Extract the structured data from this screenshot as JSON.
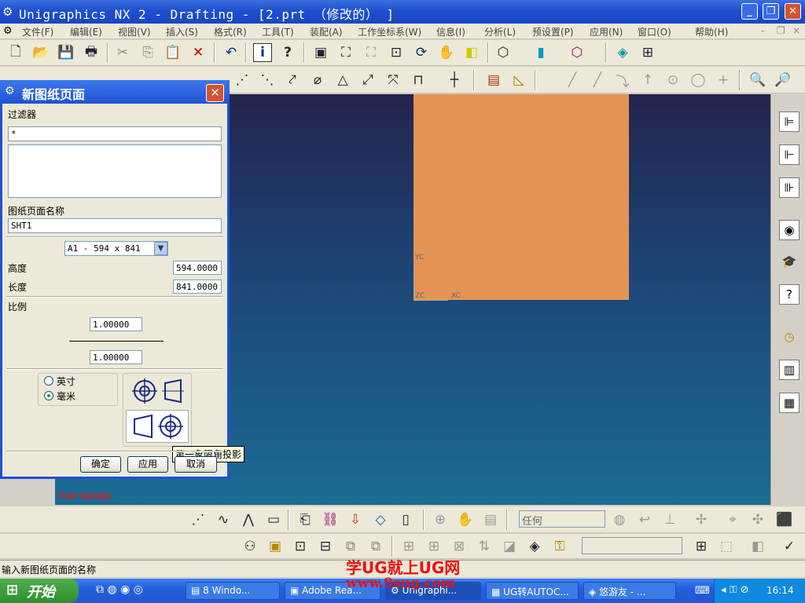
{
  "window": {
    "title": "Unigraphics NX 2 - Drafting - [2.prt  （修改的） ]",
    "btn_min": "_",
    "btn_max": "❐",
    "btn_close": "✕"
  },
  "menu": [
    {
      "label": "文件(F)"
    },
    {
      "label": "编辑(E)"
    },
    {
      "label": "视图(V)"
    },
    {
      "label": "插入(S)"
    },
    {
      "label": "格式(R)"
    },
    {
      "label": "工具(T)"
    },
    {
      "label": "装配(A)"
    },
    {
      "label": "工作坐标系(W)"
    },
    {
      "label": "信息(I)"
    },
    {
      "label": "分析(L)"
    },
    {
      "label": "预设置(P)"
    },
    {
      "label": "应用(N)"
    },
    {
      "label": "窗口(O)"
    },
    {
      "label": "帮助(H)"
    }
  ],
  "toolbar_icons": [
    "new-icon",
    "open-icon",
    "save-icon",
    "print-icon",
    "cut-icon",
    "copy-icon",
    "paste-icon",
    "delete-icon",
    "undo-icon",
    "info-icon",
    "help-icon",
    "view-icon",
    "fit-icon",
    "zoom-icon",
    "zoom-region-icon",
    "rotate-icon",
    "pan-icon",
    "shade-icon",
    "wireframe-icon",
    "render-icon",
    "box-icon",
    "model-icon",
    "sheet-icon"
  ],
  "dialog": {
    "title": "新图纸页面",
    "filter_label": "过滤器",
    "filter_value": "*",
    "name_label": "图纸页面名称",
    "name_value": "SHT1",
    "size_value": "A1 - 594 x 841",
    "height_label": "高度",
    "height_value": "594.0000",
    "length_label": "长度",
    "length_value": "841.0000",
    "scale_label": "比例",
    "scale_num": "1.00000",
    "scale_den": "1.00000",
    "unit_inch": "英寸",
    "unit_mm": "毫米",
    "unit_selected": "mm",
    "tooltip": "第一象限角投影",
    "ok": "确定",
    "apply": "应用",
    "cancel": "取消"
  },
  "canvas": {
    "label_yc": "YC",
    "label_zc": "ZC",
    "label_xc": "XC",
    "view_label": "TOP WORK"
  },
  "bottom_toolbar": {
    "filter_value": "任何"
  },
  "status_text": "输入新图纸页面的名称",
  "watermark": {
    "line1": "学UG就上UG网",
    "line2": "www.9sug.com"
  },
  "taskbar": {
    "start": "开始",
    "tasks": [
      {
        "label": "8 Windo..."
      },
      {
        "label": "Adobe Rea..."
      },
      {
        "label": "Unigraphi..."
      },
      {
        "label": "UG转AUTOC..."
      },
      {
        "label": "悠游友 - ..."
      }
    ],
    "clock": "16:14"
  },
  "colors": {
    "sheet": "#e39454",
    "titlebar": "#1f4fd0",
    "canvas_top": "#24244e",
    "canvas_bottom": "#1b6c95"
  }
}
